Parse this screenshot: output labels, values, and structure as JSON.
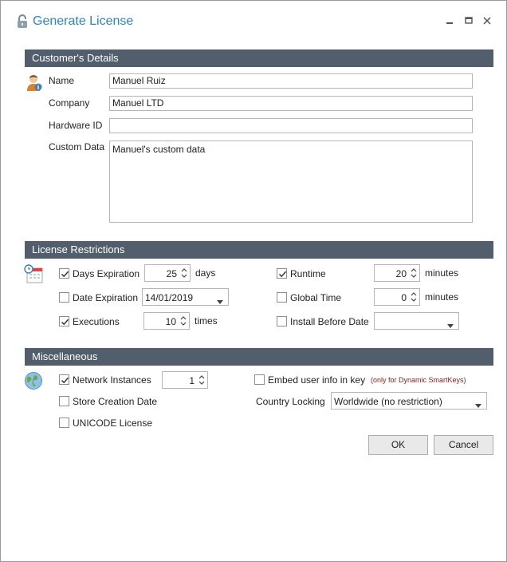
{
  "window": {
    "title": "Generate License",
    "controls": [
      "minimize",
      "maximize",
      "close"
    ]
  },
  "customer": {
    "header": "Customer's Details",
    "name_label": "Name",
    "name_value": "Manuel Ruiz",
    "company_label": "Company",
    "company_value": "Manuel LTD",
    "hardware_label": "Hardware ID",
    "hardware_value": "",
    "custom_label": "Custom Data",
    "custom_value": "Manuel's custom data"
  },
  "restrictions": {
    "header": "License Restrictions",
    "days_expiration": {
      "label": "Days Expiration",
      "checked": true,
      "value": "25",
      "unit": "days"
    },
    "date_expiration": {
      "label": "Date Expiration",
      "checked": false,
      "value": "14/01/2019"
    },
    "executions": {
      "label": "Executions",
      "checked": true,
      "value": "10",
      "unit": "times"
    },
    "runtime": {
      "label": "Runtime",
      "checked": true,
      "value": "20",
      "unit": "minutes"
    },
    "global_time": {
      "label": "Global Time",
      "checked": false,
      "value": "0",
      "unit": "minutes"
    },
    "install_before": {
      "label": "Install Before Date",
      "checked": false,
      "value": ""
    }
  },
  "misc": {
    "header": "Miscellaneous",
    "network_instances": {
      "label": "Network Instances",
      "checked": true,
      "value": "1"
    },
    "store_creation": {
      "label": "Store Creation Date",
      "checked": false
    },
    "unicode": {
      "label": "UNICODE License",
      "checked": false
    },
    "embed_user": {
      "label": "Embed user info in key",
      "checked": false,
      "note": "(only for Dynamic SmartKeys)"
    },
    "country_label": "Country Locking",
    "country_value": "Worldwide (no restriction)"
  },
  "buttons": {
    "ok": "OK",
    "cancel": "Cancel"
  },
  "colors": {
    "title": "#2a87c6",
    "section_header": "#525e6b",
    "note": "#8b1a1a"
  },
  "icons": {
    "title": "lock-icon",
    "customer": "user-icon",
    "restrictions": "calendar-clock-icon",
    "misc": "globe-icon"
  }
}
